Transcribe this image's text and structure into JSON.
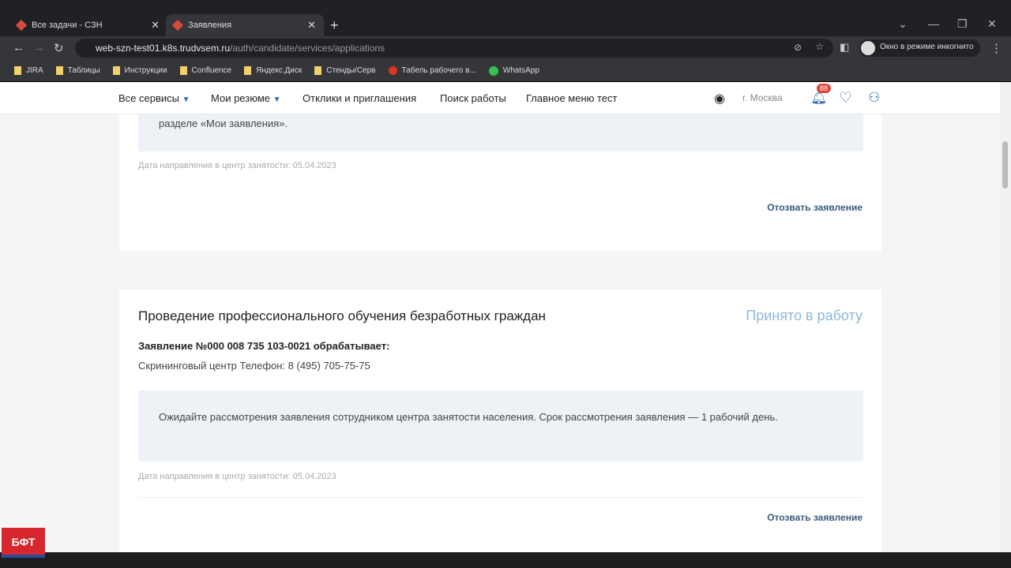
{
  "browser": {
    "tabs": [
      {
        "label": "Все задачи - СЗН"
      },
      {
        "label": "Заявления"
      }
    ],
    "url_host": "web-szn-test01.k8s.trudvsem.ru",
    "url_path": "/auth/candidate/services/applications",
    "incognito": "Окно в режиме инкогнито",
    "bookmarks": [
      "JIRA",
      "Таблицы",
      "Инструкции",
      "Confluence",
      "Яндекс.Диск",
      "Стенды/Серв",
      "Табель рабочего в...",
      "WhatsApp"
    ]
  },
  "header": {
    "nav": [
      "Все сервисы",
      "Мои резюме",
      "Отклики и приглашения",
      "Поиск работы",
      "Главное меню тест"
    ],
    "city": "г. Москва",
    "notifications": "88"
  },
  "cards": [
    {
      "note": "разделе «Мои заявления».",
      "date": "Дата направления в центр занятости: 05.04.2023",
      "revoke": "Отозвать заявление"
    },
    {
      "title": "Проведение профессионального обучения безработных граждан",
      "status": "Принято в работу",
      "number": "Заявление №000 008 735 103-0021 обрабатывает:",
      "center": "Скрининговый центр Телефон: 8 (495) 705-75-75",
      "note": "Ожидайте рассмотрения заявления сотрудником центра занятости населения. Срок рассмотрения заявления — 1 рабочий день.",
      "date": "Дата направления в центр занятости: 05.04.2023",
      "revoke": "Отозвать заявление"
    }
  ],
  "logo": "БФТ"
}
